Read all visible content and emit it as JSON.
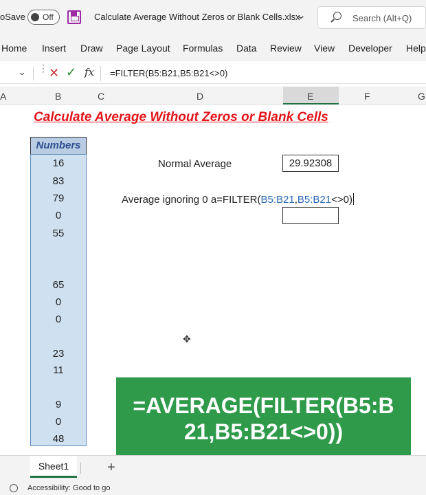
{
  "titlebar": {
    "autosave_label": "oSave",
    "toggle_text": "Off",
    "file_name": "Calculate Average Without Zeros or Blank Cells.xlsx",
    "search_placeholder": "Search (Alt+Q)"
  },
  "ribbon": {
    "tabs": [
      "Home",
      "Insert",
      "Draw",
      "Page Layout",
      "Formulas",
      "Data",
      "Review",
      "View",
      "Developer",
      "Help"
    ]
  },
  "formula_bar": {
    "cancel_symbol": "✕",
    "enter_symbol": "✓",
    "fx_label": "fx",
    "formula": "=FILTER(B5:B21,B5:B21<>0)"
  },
  "columns": [
    "A",
    "B",
    "C",
    "D",
    "E",
    "F",
    "G"
  ],
  "sheet": {
    "title": "Calculate Average Without Zeros or Blank Cells",
    "numbers_header": "Numbers",
    "numbers": [
      "16",
      "83",
      "79",
      "0",
      "55",
      "",
      "",
      "65",
      "0",
      "0",
      "",
      "23",
      "11",
      "",
      "9",
      "0",
      "48"
    ],
    "normal_average_label": "Normal Average",
    "normal_average_value": "29.92308",
    "ignoring_label": "Average ignoring 0 a",
    "formula_prefix": "=FILTER(",
    "formula_ref1": "B5:B21",
    "formula_comma": ",",
    "formula_ref2": "B5:B21",
    "formula_suffix": "<>0)",
    "banner_line1": "=AVERAGE(FILTER(B5:B",
    "banner_line2": "21,B5:B21<>0))"
  },
  "sheet_tabs": {
    "active": "Sheet1",
    "add_symbol": "+"
  },
  "status_bar": {
    "accessibility": "Accessibility: Good to go"
  },
  "colors": {
    "title_red": "#e3141a",
    "banner_green": "#2e9a4a",
    "numbers_fill": "#cfe0f0",
    "ref_blue": "#2766b5",
    "excel_green": "#217346"
  }
}
